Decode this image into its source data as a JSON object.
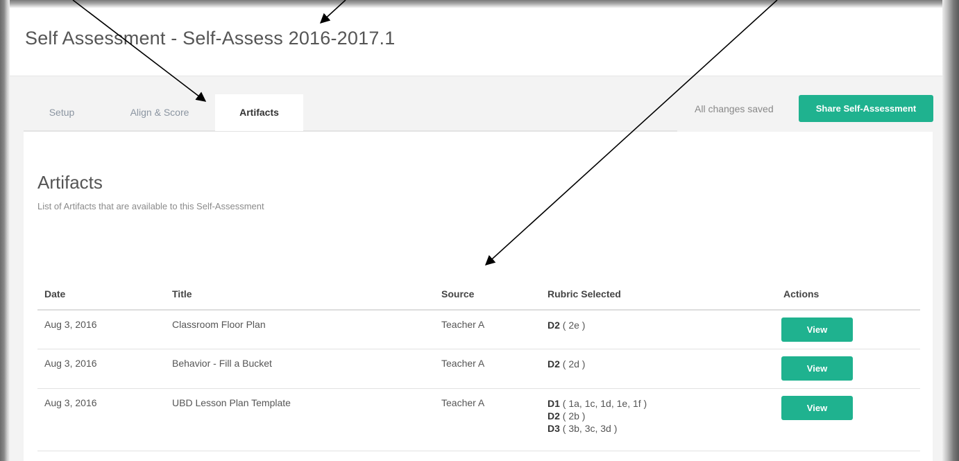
{
  "page": {
    "title": "Self Assessment - Self-Assess 2016-2017.1"
  },
  "tabs": [
    {
      "label": "Setup",
      "active": false
    },
    {
      "label": "Align & Score",
      "active": false
    },
    {
      "label": "Artifacts",
      "active": true
    }
  ],
  "status": {
    "text": "All changes saved"
  },
  "share_button": {
    "label": "Share Self-Assessment"
  },
  "section": {
    "title": "Artifacts",
    "subtitle": "List of Artifacts that are available to this Self-Assessment"
  },
  "table": {
    "headers": [
      "Date",
      "Title",
      "Source",
      "Rubric Selected",
      "Actions"
    ],
    "rows": [
      {
        "date": "Aug 3, 2016",
        "title": "Classroom Floor Plan",
        "source": "Teacher A",
        "rubric": [
          {
            "domain": "D2",
            "items": "( 2e )"
          }
        ],
        "action": "View"
      },
      {
        "date": "Aug 3, 2016",
        "title": "Behavior - Fill a Bucket",
        "source": "Teacher A",
        "rubric": [
          {
            "domain": "D2",
            "items": "( 2d )"
          }
        ],
        "action": "View"
      },
      {
        "date": "Aug 3, 2016",
        "title": "UBD Lesson Plan Template",
        "source": "Teacher A",
        "rubric": [
          {
            "domain": "D1",
            "items": "( 1a, 1c, 1d, 1e, 1f )"
          },
          {
            "domain": "D2",
            "items": "( 2b )"
          },
          {
            "domain": "D3",
            "items": "( 3b, 3c, 3d )"
          }
        ],
        "action": "View"
      }
    ]
  },
  "colors": {
    "accent": "#1fb28f",
    "panel_bg": "#f3f3f3"
  }
}
